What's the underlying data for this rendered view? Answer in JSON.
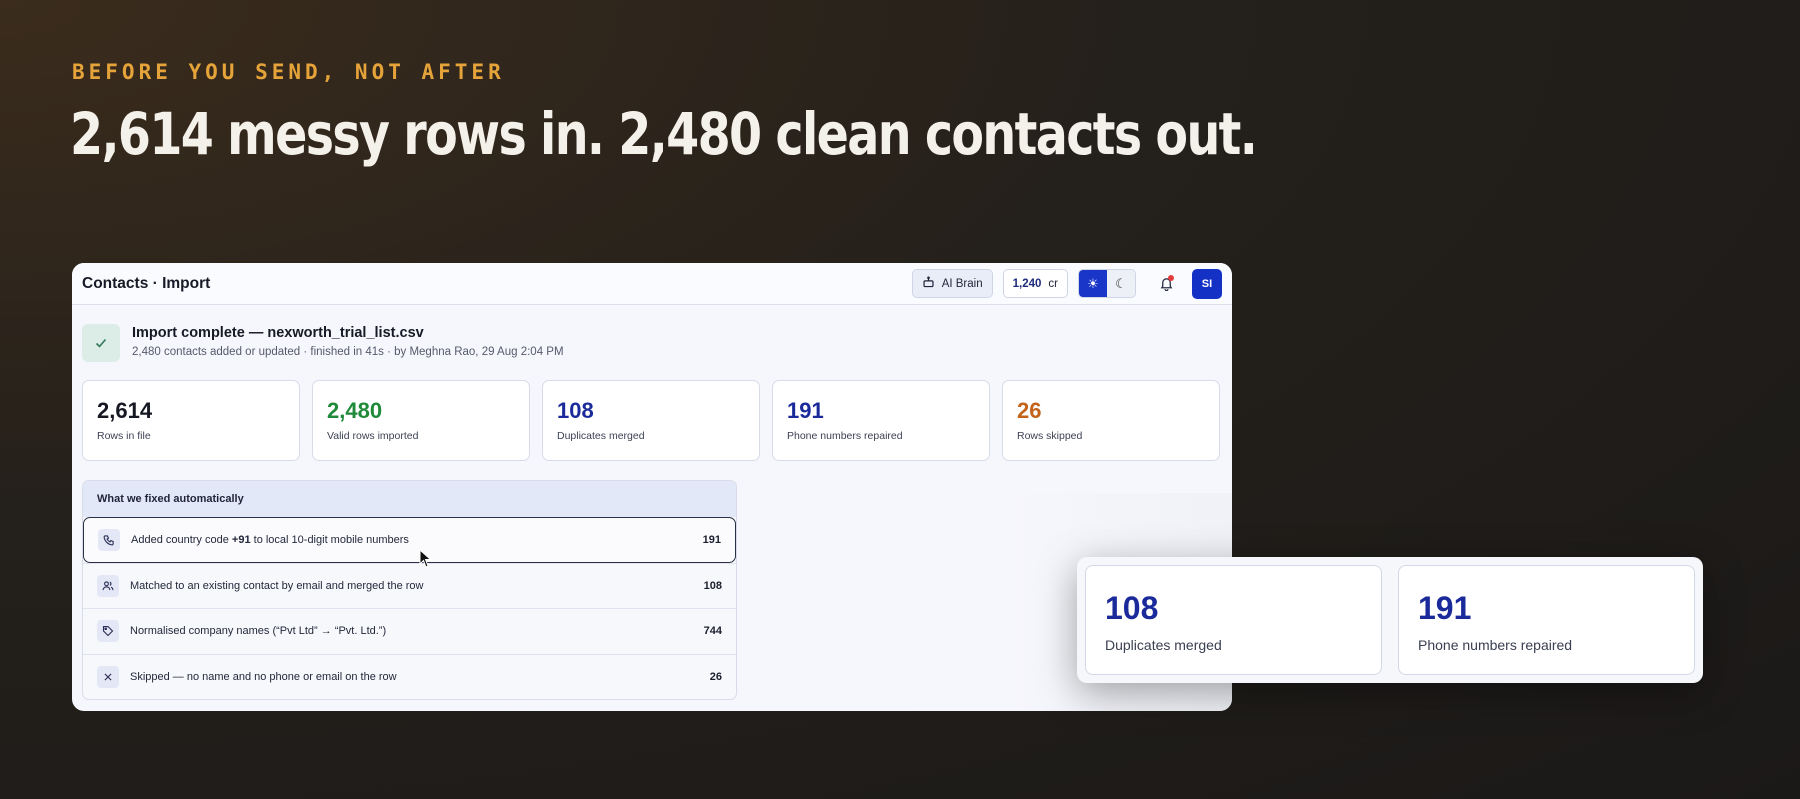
{
  "hero": {
    "eyebrow": "BEFORE YOU SEND, NOT AFTER",
    "headline": "2,614 messy rows in. 2,480 clean contacts out."
  },
  "header": {
    "title": "Contacts · Import",
    "ai_brain": "AI Brain",
    "credits_value": "1,240",
    "credits_unit": "cr",
    "avatar": "SI"
  },
  "banner": {
    "title": "Import complete — nexworth_trial_list.csv",
    "subtitle": "2,480 contacts added or updated · finished in 41s · by Meghna Rao, 29 Aug 2:04 PM"
  },
  "stats": [
    {
      "value": "2,614",
      "label": "Rows in file",
      "color": "#151822"
    },
    {
      "value": "2,480",
      "label": "Valid rows imported",
      "color": "#1f8a3a"
    },
    {
      "value": "108",
      "label": "Duplicates merged",
      "color": "#1a2a9a"
    },
    {
      "value": "191",
      "label": "Phone numbers repaired",
      "color": "#1a2a9a"
    },
    {
      "value": "26",
      "label": "Rows skipped",
      "color": "#c4641a"
    }
  ],
  "fixes": {
    "title": "What we fixed automatically",
    "rows": [
      {
        "pre": "Added country code ",
        "bold": "+91",
        "post": " to local 10-digit mobile numbers",
        "count": "191",
        "icon": "phone-icon"
      },
      {
        "text": "Matched to an existing contact by email and merged the row",
        "count": "108",
        "icon": "users-icon"
      },
      {
        "text": "Normalised company names (“Pvt Ltd” → “Pvt. Ltd.”)",
        "count": "744",
        "icon": "tag-icon"
      },
      {
        "text": "Skipped — no name and no phone or email on the row",
        "count": "26",
        "icon": "x-icon"
      }
    ]
  },
  "zoom": [
    {
      "value": "108",
      "label": "Duplicates merged"
    },
    {
      "value": "191",
      "label": "Phone numbers repaired"
    }
  ]
}
